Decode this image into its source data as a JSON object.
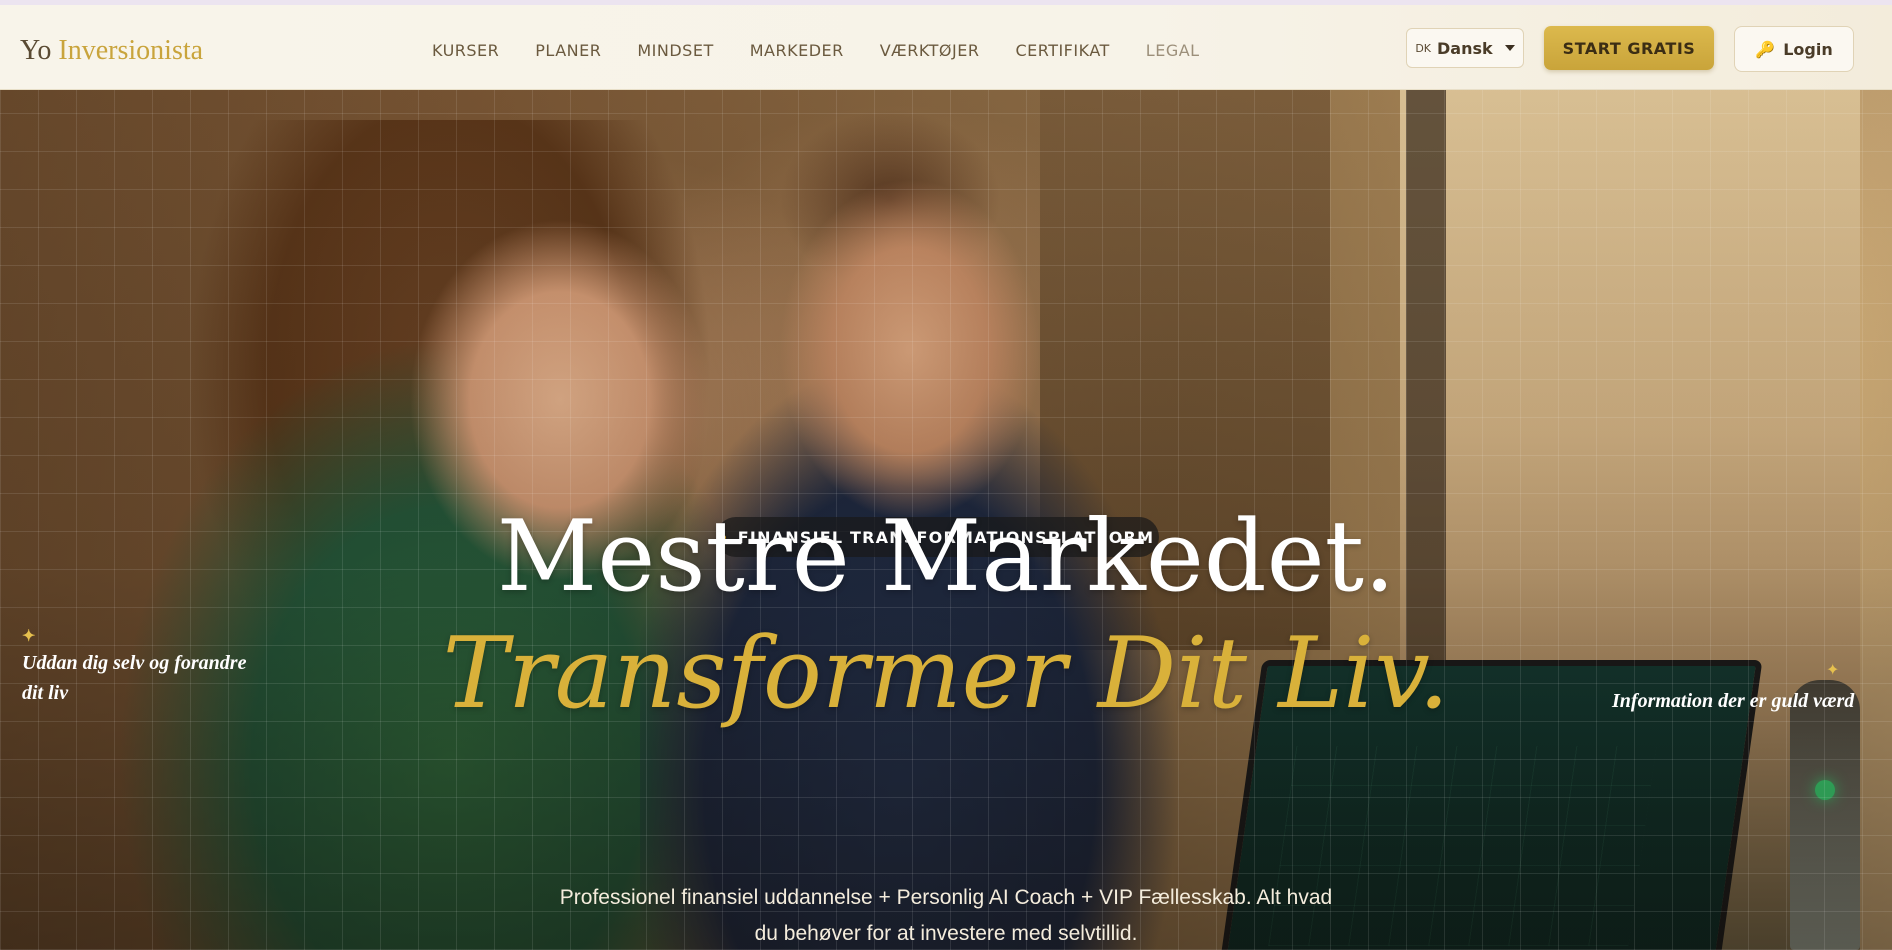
{
  "nav": {
    "logo_prefix": "Yo",
    "logo_brand": "Inversionista",
    "links": [
      {
        "label": "KURSER"
      },
      {
        "label": "PLANER"
      },
      {
        "label": "MINDSET"
      },
      {
        "label": "MARKEDER"
      },
      {
        "label": "VÆRKTØJER"
      },
      {
        "label": "CERTIFIKAT"
      },
      {
        "label": "LEGAL"
      }
    ],
    "language": {
      "code": "DK",
      "name": "Dansk"
    },
    "start_label": "START GRATIS",
    "login_label": "Login",
    "colors": {
      "accent_gold": "#d9b13a",
      "nav_text": "#6b5a3f"
    }
  },
  "hero": {
    "badge": "FINANSIEL TRANSFORMATIONSPLATFORM",
    "headline_1": "Mestre Markedet.",
    "headline_2": "Transformer Dit Liv.",
    "subtext": "Professionel finansiel uddannelse + Personlig AI Coach + VIP Fællesskab. Alt hvad du behøver for at investere med selvtillid.",
    "side_left": "Uddan dig selv og forandre dit liv",
    "side_right": "Information der er guld værd",
    "spark_icon": "✦",
    "key_icon": "🔑"
  }
}
